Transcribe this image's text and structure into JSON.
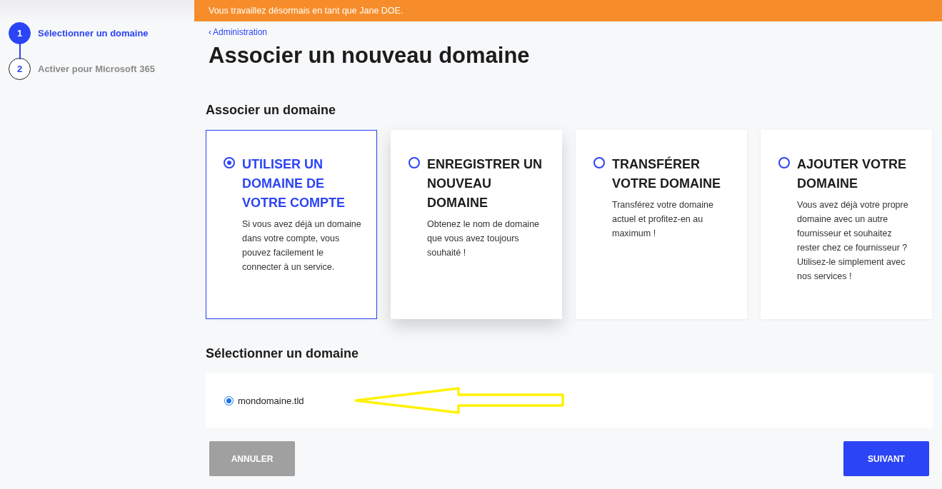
{
  "steps": [
    {
      "number": "1",
      "label": "Sélectionner un domaine",
      "selected": true
    },
    {
      "number": "2",
      "label": "Activer pour Microsoft 365",
      "selected": false
    }
  ],
  "banner": "Vous travaillez désormais en tant que Jane DOE.",
  "breadcrumb": {
    "icon": "‹",
    "label": "Administration"
  },
  "title": "Associer un nouveau domaine",
  "options_heading": "Associer un domaine",
  "options": [
    {
      "title": "UTILISER UN DOMAINE DE VOTRE COMPTE",
      "description": "Si vous avez déjà un domaine dans votre compte, vous pouvez facilement le connecter à un service.",
      "selected": true,
      "hovered": false
    },
    {
      "title": "ENREGISTRER UN NOUVEAU DOMAINE",
      "description": "Obtenez le nom de domaine que vous avez toujours souhaité !",
      "selected": false,
      "hovered": true
    },
    {
      "title": "TRANSFÉRER VOTRE DOMAINE",
      "description": "Transférez votre domaine actuel et profitez-en au maximum !",
      "selected": false,
      "hovered": false
    },
    {
      "title": "AJOUTER VOTRE DOMAINE",
      "description": "Vous avez déjà votre propre domaine avec un autre fournisseur et souhaitez rester chez ce fournisseur ? Utilisez-le simplement avec nos services !",
      "selected": false,
      "hovered": false
    }
  ],
  "domains_heading": "Sélectionner un domaine",
  "domains": [
    {
      "name": "mondomaine.tld",
      "selected": true
    }
  ],
  "buttons": [
    {
      "kind": "secondary",
      "label": "ANNULER"
    },
    {
      "kind": "primary",
      "label": "SUIVANT"
    }
  ]
}
